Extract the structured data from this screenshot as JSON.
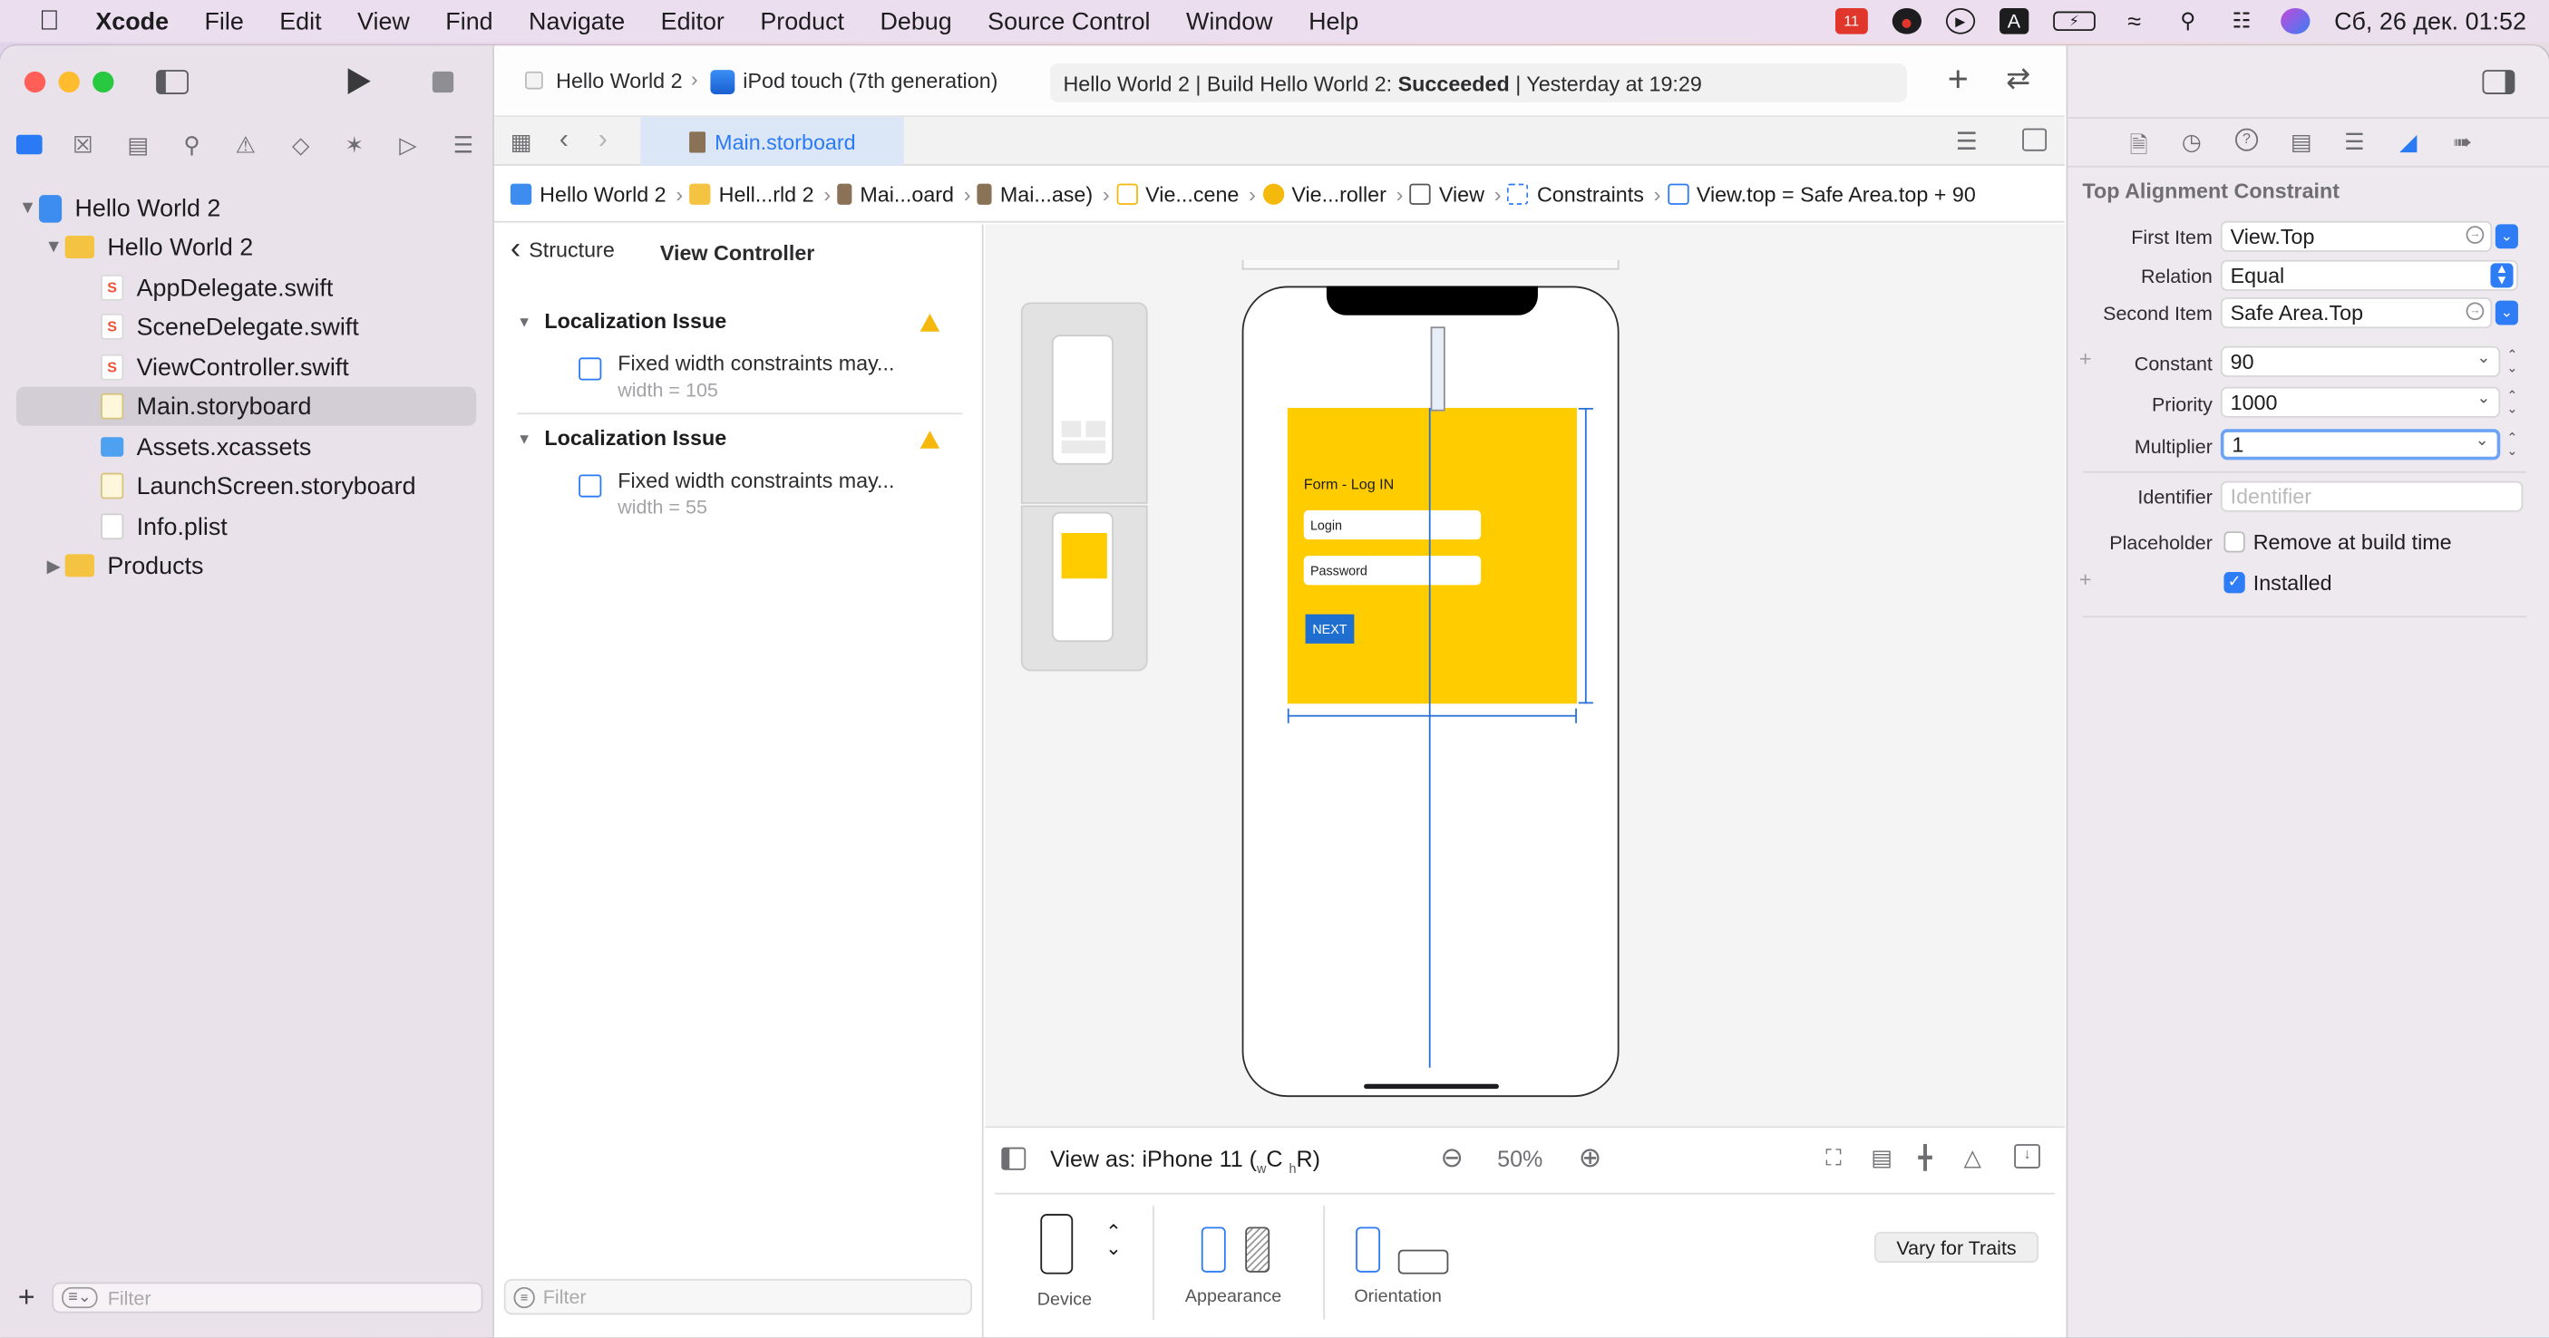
{
  "menubar": {
    "app": "Xcode",
    "items": [
      "File",
      "Edit",
      "View",
      "Find",
      "Navigate",
      "Editor",
      "Product",
      "Debug",
      "Source Control",
      "Window",
      "Help"
    ],
    "badge": "11",
    "keyboard": "A",
    "datetime": "Сб, 26 дек.  01:52"
  },
  "toolbar": {
    "scheme": "Hello World 2",
    "device": "iPod touch (7th generation)",
    "status_prefix": "Hello World 2 | Build Hello World 2: ",
    "status_result": "Succeeded",
    "status_suffix": " | Yesterday at 19:29"
  },
  "tabs": {
    "active": "Main.storboard"
  },
  "navigator": {
    "items": [
      {
        "label": "Hello World 2",
        "depth": 0,
        "icon": "project",
        "expanded": true
      },
      {
        "label": "Hello World 2",
        "depth": 1,
        "icon": "folder",
        "expanded": true
      },
      {
        "label": "AppDelegate.swift",
        "depth": 2,
        "icon": "swift"
      },
      {
        "label": "SceneDelegate.swift",
        "depth": 2,
        "icon": "swift"
      },
      {
        "label": "ViewController.swift",
        "depth": 2,
        "icon": "swift"
      },
      {
        "label": "Main.storyboard",
        "depth": 2,
        "icon": "storyboard",
        "selected": true
      },
      {
        "label": "Assets.xcassets",
        "depth": 2,
        "icon": "assets"
      },
      {
        "label": "LaunchScreen.storyboard",
        "depth": 2,
        "icon": "storyboard"
      },
      {
        "label": "Info.plist",
        "depth": 2,
        "icon": "plist"
      },
      {
        "label": "Products",
        "depth": 1,
        "icon": "folder",
        "expanded": false
      }
    ],
    "filter_placeholder": "Filter"
  },
  "jumpbar": [
    "Hello World 2",
    "Hell...rld 2",
    "Mai...oard",
    "Mai...ase)",
    "Vie...cene",
    "Vie...roller",
    "View",
    "Constraints",
    "View.top = Safe Area.top + 90"
  ],
  "outline": {
    "back": "Structure",
    "title": "View Controller",
    "issues": [
      {
        "header": "Localization Issue",
        "text": "Fixed width constraints may...",
        "sub": "width = 105"
      },
      {
        "header": "Localization Issue",
        "text": "Fixed width constraints may...",
        "sub": "width = 55"
      }
    ],
    "filter_placeholder": "Filter"
  },
  "canvas": {
    "form_title": "Form - Log IN",
    "login_placeholder": "Login",
    "password_placeholder": "Password",
    "next": "NEXT"
  },
  "bottombar": {
    "view_as_prefix": "View as: iPhone 11 (",
    "w": "w",
    "c": "C",
    "h": "h",
    "r": "R",
    "view_as_suffix": ")",
    "zoom": "50%",
    "device": "Device",
    "appearance": "Appearance",
    "orientation": "Orientation",
    "vary": "Vary for Traits"
  },
  "inspector": {
    "title": "Top Alignment Constraint",
    "first_item_label": "First Item",
    "first_item": "View.Top",
    "relation_label": "Relation",
    "relation": "Equal",
    "second_item_label": "Second Item",
    "second_item": "Safe Area.Top",
    "constant_label": "Constant",
    "constant": "90",
    "priority_label": "Priority",
    "priority": "1000",
    "multiplier_label": "Multiplier",
    "multiplier": "1",
    "identifier_label": "Identifier",
    "identifier_placeholder": "Identifier",
    "placeholder_label": "Placeholder",
    "placeholder_text": "Remove at build time",
    "installed": "Installed"
  },
  "colors": {
    "accent": "#2b7af5",
    "form_bg": "#ffcc00",
    "next_bg": "#1f6fd1"
  }
}
